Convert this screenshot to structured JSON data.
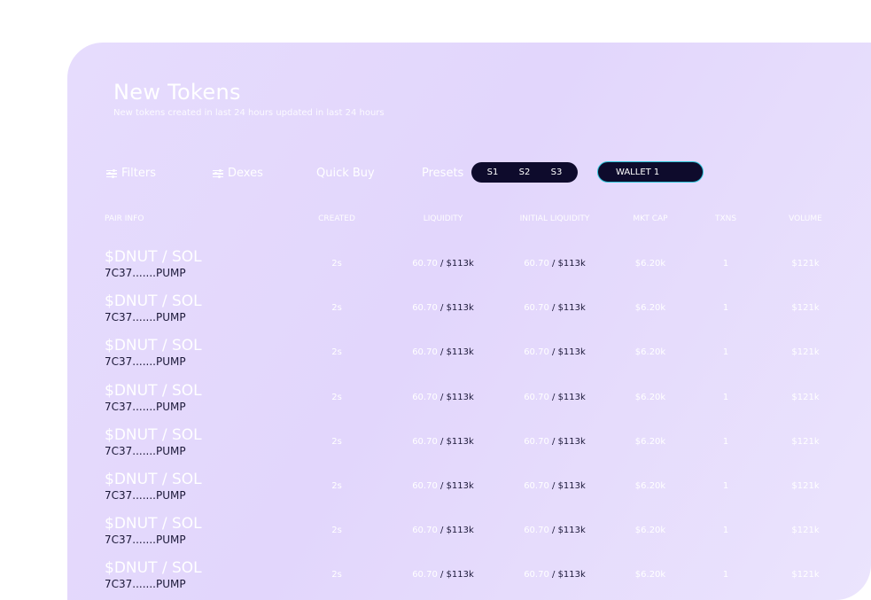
{
  "header": {
    "title": "New Tokens",
    "subtitle": "New tokens created in last 24 hours updated in last 24 hours"
  },
  "toolbar": {
    "filters_label": "Filters",
    "dexes_label": "Dexes",
    "quick_buy_label": "Quick Buy",
    "presets_label": "Presets",
    "presets": [
      "S1",
      "S2",
      "S3"
    ],
    "wallet_label": "WALLET 1"
  },
  "colors": {
    "panel_bg": "#e4d9fd",
    "dark_pill": "#0e0b2c",
    "wallet_border": "#2ec5d9"
  },
  "table": {
    "columns": [
      "PAIR INFO",
      "CREATED",
      "LIQUIDITY",
      "INITIAL LIQUIDITY",
      "MKT CAP",
      "TXNS",
      "VOLUME"
    ],
    "rows": [
      {
        "pair": "$DNUT / SOL",
        "address": "7C37.......PUMP",
        "created": "2s",
        "liquidity_sol": "60.70",
        "liquidity_usd": "/ $113k",
        "init_sol": "60.70",
        "init_usd": "/ $113k",
        "mkt_cap": "$6.20k",
        "txns": "1",
        "volume": "$121k"
      },
      {
        "pair": "$DNUT / SOL",
        "address": "7C37.......PUMP",
        "created": "2s",
        "liquidity_sol": "60.70",
        "liquidity_usd": "/ $113k",
        "init_sol": "60.70",
        "init_usd": "/ $113k",
        "mkt_cap": "$6.20k",
        "txns": "1",
        "volume": "$121k"
      },
      {
        "pair": "$DNUT / SOL",
        "address": "7C37.......PUMP",
        "created": "2s",
        "liquidity_sol": "60.70",
        "liquidity_usd": "/ $113k",
        "init_sol": "60.70",
        "init_usd": "/ $113k",
        "mkt_cap": "$6.20k",
        "txns": "1",
        "volume": "$121k"
      },
      {
        "pair": "$DNUT / SOL",
        "address": "7C37.......PUMP",
        "created": "2s",
        "liquidity_sol": "60.70",
        "liquidity_usd": "/ $113k",
        "init_sol": "60.70",
        "init_usd": "/ $113k",
        "mkt_cap": "$6.20k",
        "txns": "1",
        "volume": "$121k"
      },
      {
        "pair": "$DNUT / SOL",
        "address": "7C37.......PUMP",
        "created": "2s",
        "liquidity_sol": "60.70",
        "liquidity_usd": "/ $113k",
        "init_sol": "60.70",
        "init_usd": "/ $113k",
        "mkt_cap": "$6.20k",
        "txns": "1",
        "volume": "$121k"
      },
      {
        "pair": "$DNUT / SOL",
        "address": "7C37.......PUMP",
        "created": "2s",
        "liquidity_sol": "60.70",
        "liquidity_usd": "/ $113k",
        "init_sol": "60.70",
        "init_usd": "/ $113k",
        "mkt_cap": "$6.20k",
        "txns": "1",
        "volume": "$121k"
      },
      {
        "pair": "$DNUT / SOL",
        "address": "7C37.......PUMP",
        "created": "2s",
        "liquidity_sol": "60.70",
        "liquidity_usd": "/ $113k",
        "init_sol": "60.70",
        "init_usd": "/ $113k",
        "mkt_cap": "$6.20k",
        "txns": "1",
        "volume": "$121k"
      },
      {
        "pair": "$DNUT / SOL",
        "address": "7C37.......PUMP",
        "created": "2s",
        "liquidity_sol": "60.70",
        "liquidity_usd": "/ $113k",
        "init_sol": "60.70",
        "init_usd": "/ $113k",
        "mkt_cap": "$6.20k",
        "txns": "1",
        "volume": "$121k"
      }
    ]
  }
}
